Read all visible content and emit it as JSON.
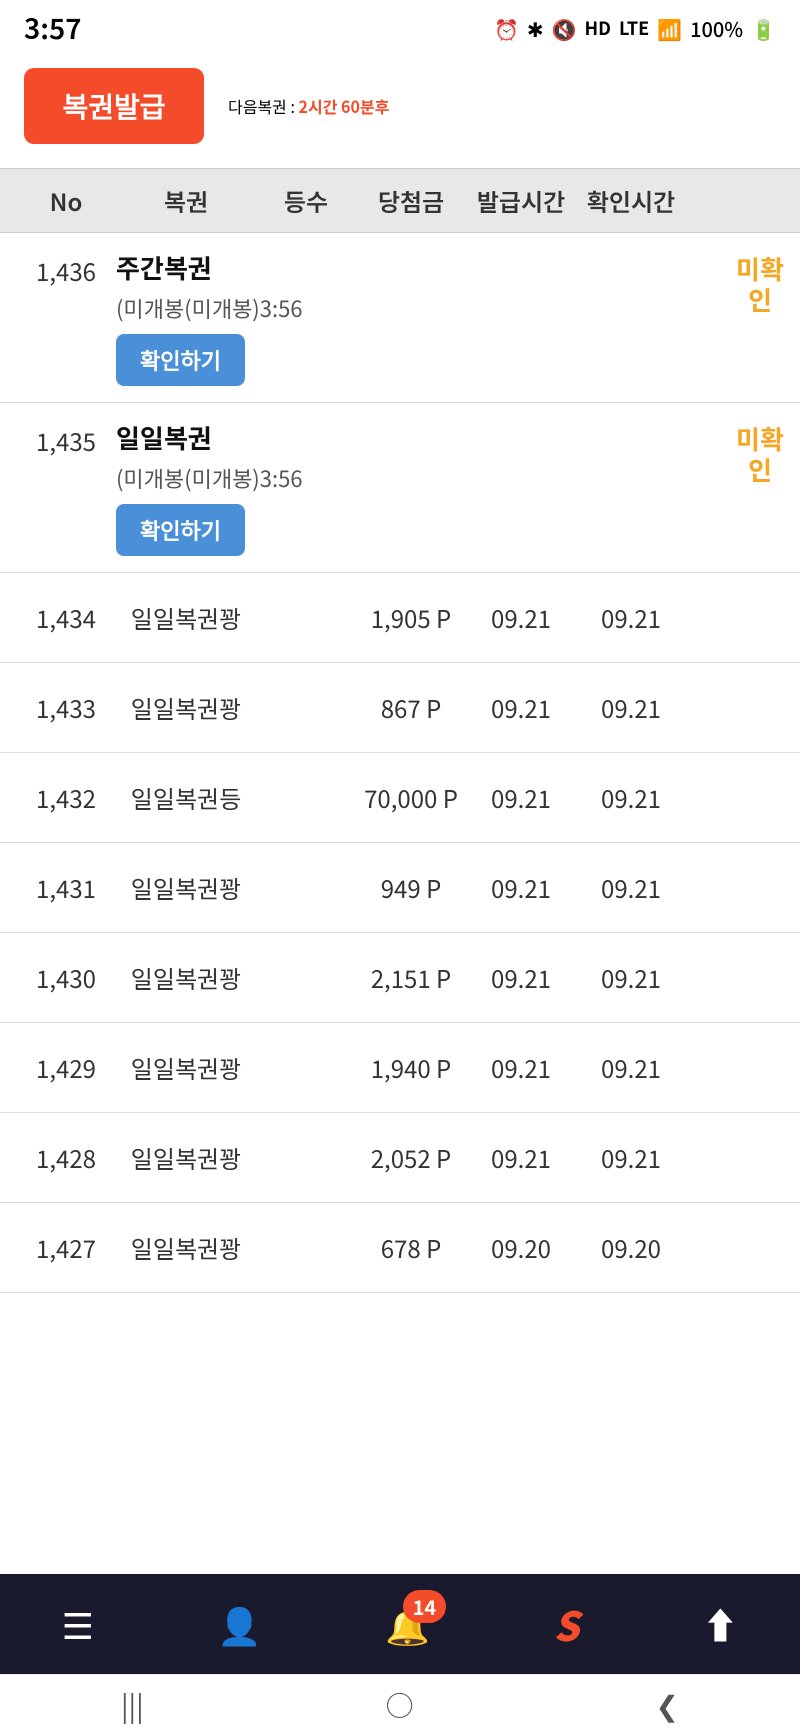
{
  "statusBar": {
    "time": "3:57",
    "battery": "100%"
  },
  "header": {
    "btnLabel": "복권발급",
    "nextLabel": "다음복권 : ",
    "nextTime": "2시간 60분후"
  },
  "tableHeaders": {
    "no": "No",
    "type": "복권",
    "rank": "등수",
    "prize": "당첨금",
    "issueTime": "발급시간",
    "confirmTime": "확인시간"
  },
  "specialRows": [
    {
      "no": "1,436",
      "title": "주간복권",
      "info": "(미개봉(미개봉)3:56",
      "btnLabel": "확인하기",
      "status": "미확인"
    },
    {
      "no": "1,435",
      "title": "일일복권",
      "info": "(미개봉(미개봉)3:56",
      "btnLabel": "확인하기",
      "status": "미확인"
    }
  ],
  "rows": [
    {
      "no": "1,434",
      "type": "일일복권꽝",
      "rank": "",
      "prize": "1,905",
      "prizeUnit": "P",
      "issueTime": "09.21",
      "confirmTime": "09.21"
    },
    {
      "no": "1,433",
      "type": "일일복권꽝",
      "rank": "",
      "prize": "867",
      "prizeUnit": "P",
      "issueTime": "09.21",
      "confirmTime": "09.21"
    },
    {
      "no": "1,432",
      "type": "일일복권등",
      "rank": "",
      "prize": "70,000",
      "prizeUnit": "P",
      "issueTime": "09.21",
      "confirmTime": "09.21"
    },
    {
      "no": "1,431",
      "type": "일일복권꽝",
      "rank": "",
      "prize": "949",
      "prizeUnit": "P",
      "issueTime": "09.21",
      "confirmTime": "09.21"
    },
    {
      "no": "1,430",
      "type": "일일복권꽝",
      "rank": "",
      "prize": "2,151",
      "prizeUnit": "P",
      "issueTime": "09.21",
      "confirmTime": "09.21"
    },
    {
      "no": "1,429",
      "type": "일일복권꽝",
      "rank": "",
      "prize": "1,940",
      "prizeUnit": "P",
      "issueTime": "09.21",
      "confirmTime": "09.21"
    },
    {
      "no": "1,428",
      "type": "일일복권꽝",
      "rank": "",
      "prize": "2,052",
      "prizeUnit": "P",
      "issueTime": "09.21",
      "confirmTime": "09.21"
    },
    {
      "no": "1,427",
      "type": "일일복권꽝",
      "rank": "",
      "prize": "678",
      "prizeUnit": "P",
      "issueTime": "09.20",
      "confirmTime": "09.20"
    }
  ],
  "bottomNav": {
    "menuIcon": "≡",
    "userIcon": "👤",
    "bellBadge": "14",
    "sLabel": "S",
    "upIcon": "⬆"
  },
  "androidNav": {
    "back": "❮",
    "home": "○",
    "recent": "|||"
  }
}
